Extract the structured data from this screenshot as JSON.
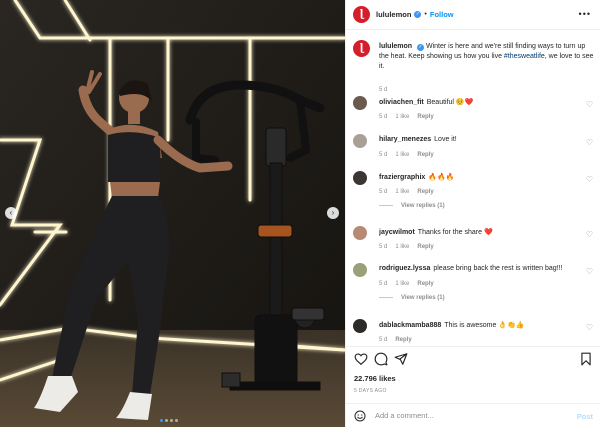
{
  "account": {
    "username": "lululemon",
    "follow_label": "Follow",
    "separator": "•",
    "more_label": "•••"
  },
  "caption": {
    "username": "lululemon",
    "text_before": "Winter is here and we're still finding ways to turn up the heat. Keep showing us how you live ",
    "hashtag": "#thesweatlife",
    "text_after": ", we love to see it.",
    "time": "5 d"
  },
  "comments": [
    {
      "username": "oliviachen_fit",
      "text": "Beautiful 🥺❤️",
      "time": "5 d",
      "likes": "1 like",
      "reply": "Reply",
      "avatar_color": "#6b5a4e"
    },
    {
      "username": "hilary_menezes",
      "text": "Love it!",
      "time": "5 d",
      "likes": "1 like",
      "reply": "Reply",
      "avatar_color": "#a89f95"
    },
    {
      "username": "fraziergraphix",
      "text": "🔥🔥🔥",
      "time": "5 d",
      "likes": "1 like",
      "reply": "Reply",
      "view_replies": "View replies (1)",
      "avatar_color": "#3b3633"
    },
    {
      "username": "jaycwilmot",
      "text": "Thanks for the share ❤️",
      "time": "5 d",
      "likes": "1 like",
      "reply": "Reply",
      "avatar_color": "#b88a74"
    },
    {
      "username": "rodriguez.lyssa",
      "text": "please bring back the rest is written bag!!!",
      "time": "5 d",
      "likes": "1 like",
      "reply": "Reply",
      "view_replies": "View replies (1)",
      "avatar_color": "#9aa07a"
    },
    {
      "username": "dablackmamba888",
      "text": "This is awesome 👌👏👍",
      "time": "5 d",
      "reply": "Reply",
      "avatar_color": "#2e2a28"
    }
  ],
  "stats": {
    "likes": "22.796 likes",
    "date": "5 DAYS AGO"
  },
  "add_comment": {
    "placeholder": "Add a comment...",
    "post_label": "Post"
  },
  "nav": {
    "prev": "‹",
    "next": "›"
  },
  "carousel": {
    "dots": 4,
    "active": 0
  },
  "icons": [
    "heart-icon",
    "comment-icon",
    "share-icon",
    "bookmark-icon",
    "emoji-icon",
    "verified-icon",
    "chevron-left-icon",
    "chevron-right-icon"
  ],
  "colors": {
    "accent": "#0095f6",
    "brand": "#d31f2b",
    "neon": "#fff3c4",
    "like": "#ed4956"
  }
}
